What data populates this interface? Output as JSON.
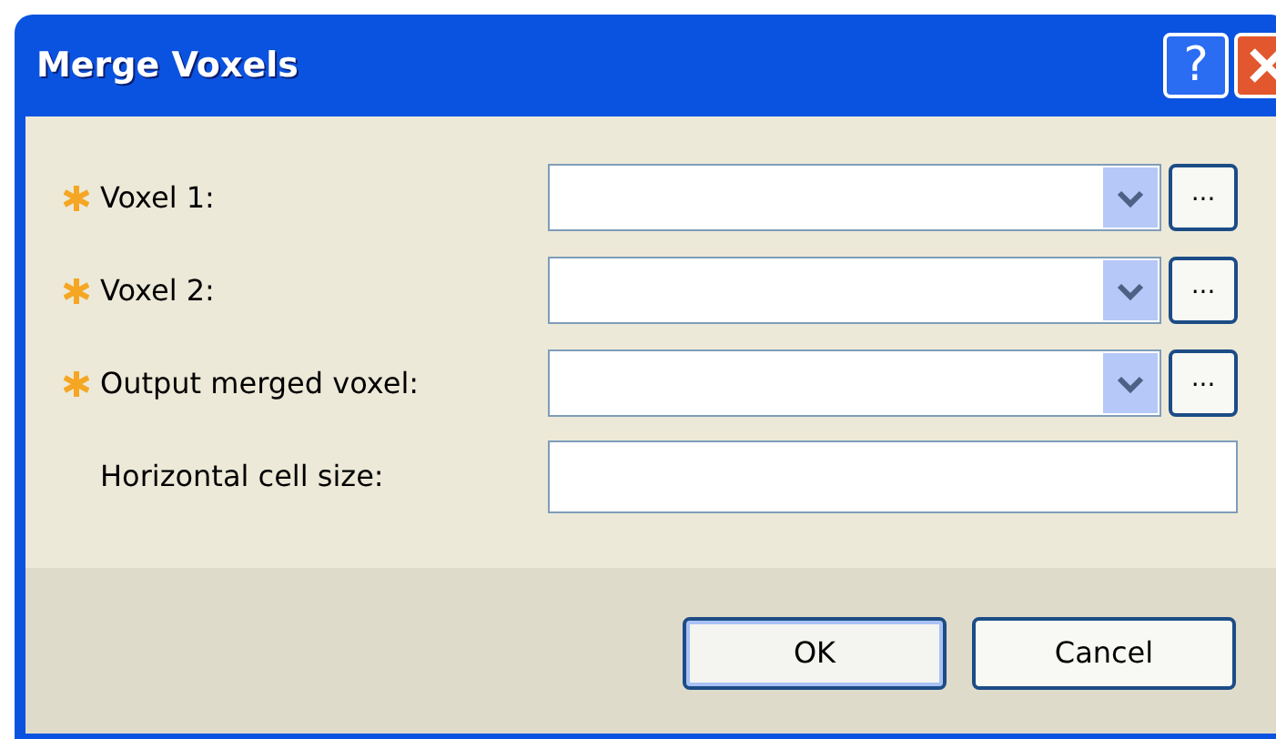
{
  "window": {
    "title": "Merge Voxels",
    "help": "?"
  },
  "fields": [
    {
      "label": "Voxel 1:",
      "required": true,
      "kind": "combo",
      "browse": "..."
    },
    {
      "label": "Voxel 2:",
      "required": true,
      "kind": "combo",
      "browse": "..."
    },
    {
      "label": "Output merged voxel:",
      "required": true,
      "kind": "combo",
      "browse": "..."
    },
    {
      "label": "Horizontal cell size:",
      "required": false,
      "kind": "text"
    }
  ],
  "buttons": [
    {
      "label": "OK",
      "default": true
    },
    {
      "label": "Cancel",
      "default": false
    }
  ]
}
